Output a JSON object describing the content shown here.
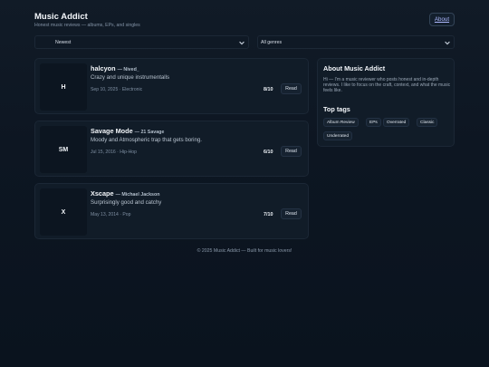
{
  "header": {
    "title": "Music Addict",
    "tagline": "Honest music reviews — albums, EPs, and singles",
    "about_label": "About"
  },
  "filters": {
    "sort_value": "Newest",
    "genre_value": "All genres"
  },
  "reviews": [
    {
      "initials": "H",
      "title": "halcyon",
      "artist": "— Nived_",
      "description": "Crazy and unique instrumentalls",
      "meta": "Sep 10, 2025 · Electronic",
      "score": "8/10",
      "read_label": "Read"
    },
    {
      "initials": "SM",
      "title": "Savage Mode",
      "artist": "— 21 Savage",
      "description": "Moody and Atmospheric trap that gets boring.",
      "meta": "Jul 15, 2016 · Hip-Hop",
      "score": "6/10",
      "read_label": "Read"
    },
    {
      "initials": "X",
      "title": "Xscape",
      "artist": "— Michael Jackson",
      "description": "Surprisingly good and catchy",
      "meta": "May 13, 2014 · Pop",
      "score": "7/10",
      "read_label": "Read"
    }
  ],
  "sidebar": {
    "about_heading": "About Music Addict",
    "about_text": "Hi — I'm a music reviewer who posts honest and in-depth reviews. I like to focus on the craft, context, and what the music feels like.",
    "tags_heading": "Top tags",
    "tags": [
      "Album Review",
      "EPs",
      "Overrated",
      "Classic",
      "Underrated"
    ]
  },
  "footer": {
    "text": "© 2025 Music Addict — Built for music lovers!"
  },
  "colors": {
    "background": "#0d1622",
    "card": "#111c28",
    "link": "#aeb9ff"
  }
}
